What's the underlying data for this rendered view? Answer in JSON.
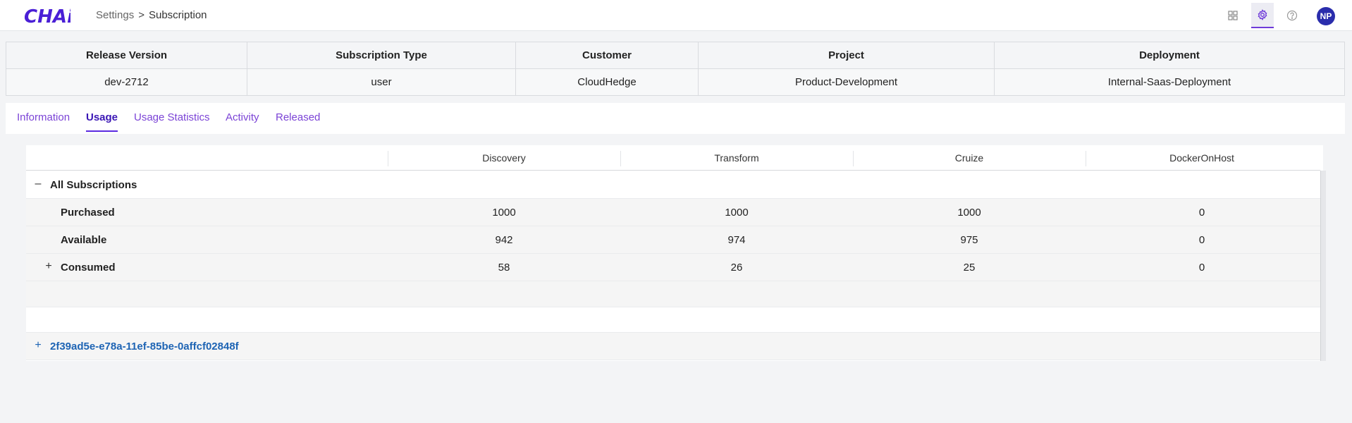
{
  "app": {
    "logo_text": "CHAi",
    "brand_color": "#4a1fd6"
  },
  "breadcrumb": {
    "parent": "Settings",
    "separator": ">",
    "current": "Subscription"
  },
  "header_icons": [
    "grid-icon",
    "gear-icon",
    "help-icon"
  ],
  "user": {
    "initials": "NP"
  },
  "summary": {
    "columns": [
      "Release Version",
      "Subscription Type",
      "Customer",
      "Project",
      "Deployment"
    ],
    "values": [
      "dev-2712",
      "user",
      "CloudHedge",
      "Product-Development",
      "Internal-Saas-Deployment"
    ]
  },
  "tabs": [
    {
      "label": "Information",
      "active": false
    },
    {
      "label": "Usage",
      "active": true
    },
    {
      "label": "Usage Statistics",
      "active": false
    },
    {
      "label": "Activity",
      "active": false
    },
    {
      "label": "Released",
      "active": false
    }
  ],
  "usage": {
    "columns": [
      "Discovery",
      "Transform",
      "Cruize",
      "DockerOnHost"
    ],
    "group": {
      "toggle": "–",
      "label": "All Subscriptions"
    },
    "rows": [
      {
        "label": "Purchased",
        "values": [
          "1000",
          "1000",
          "1000",
          "0"
        ]
      },
      {
        "label": "Available",
        "values": [
          "942",
          "974",
          "975",
          "0"
        ]
      },
      {
        "label": "Consumed",
        "toggle": "+",
        "values": [
          "58",
          "26",
          "25",
          "0"
        ]
      }
    ],
    "subscription_id": {
      "toggle": "+",
      "label": "2f39ad5e-e78a-11ef-85be-0affcf02848f"
    }
  }
}
